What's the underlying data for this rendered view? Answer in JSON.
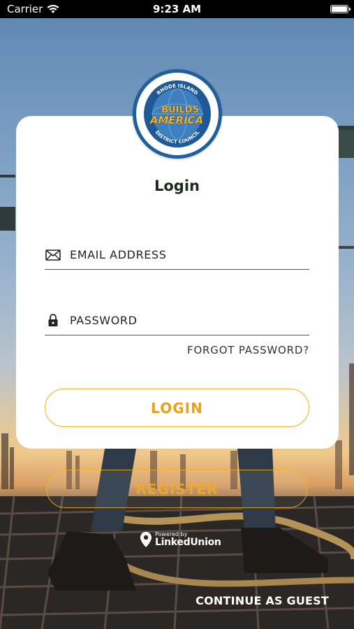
{
  "status_bar": {
    "carrier": "Carrier",
    "time": "9:23 AM"
  },
  "logo": {
    "top_text": "RHODE ISLAND",
    "main_text_1": "BUILDS",
    "main_text_2": "AMERICA",
    "bottom_text": "DISTRICT COUNCIL"
  },
  "login": {
    "title": "Login",
    "email_placeholder": "EMAIL ADDRESS",
    "password_placeholder": "PASSWORD",
    "forgot_label": "FORGOT PASSWORD?",
    "login_button": "LOGIN"
  },
  "register_button": "REGISTER",
  "powered_by": {
    "label": "Powered by",
    "brand": "LinkedUnion"
  },
  "guest_link": "CONTINUE AS GUEST",
  "colors": {
    "accent": "#f0b125",
    "logo_ring": "#1f5f9c"
  }
}
